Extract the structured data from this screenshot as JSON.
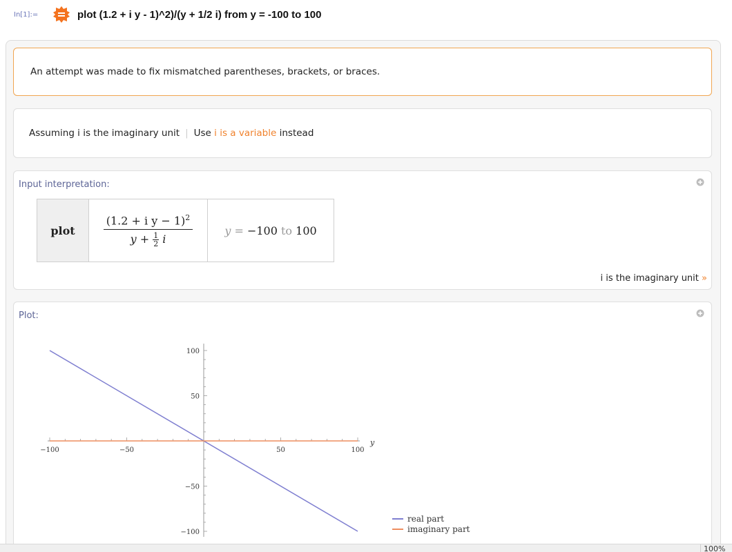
{
  "input_line": {
    "label": "In[1]:=",
    "query": "plot (1.2 + i y - 1)^2)/(y + 1/2 i) from y = -100 to 100",
    "icon": "wolfram-alpha-icon"
  },
  "warning_pod": {
    "text": "An attempt was made to fix mismatched parentheses, brackets, or braces."
  },
  "assumption_pod": {
    "prefix": "Assuming i is the imaginary unit",
    "separator": "|",
    "use_label": "Use",
    "link_text": "i is a variable",
    "suffix": "instead"
  },
  "interpretation_pod": {
    "title": "Input interpretation:",
    "plot_label": "plot",
    "numerator": "(1.2 + i y − 1)",
    "exponent": "2",
    "denominator_var": "y +",
    "small_num": "1",
    "small_den": "2",
    "denominator_i": "i",
    "range_var": "y =",
    "range_from": "−100",
    "range_to_word": "to",
    "range_to": "100",
    "assumption_text": "i is the imaginary unit",
    "assumption_arrow": "»"
  },
  "plot_pod": {
    "title": "Plot:"
  },
  "chart_data": {
    "type": "line",
    "x": [
      -100,
      100
    ],
    "series": [
      {
        "name": "real part",
        "values": [
          100,
          -100
        ],
        "color": "#7e7ed0"
      },
      {
        "name": "imaginary part",
        "values": [
          0,
          0
        ],
        "color": "#ee8d5f"
      }
    ],
    "xlabel": "y",
    "ylabel": "",
    "xlim": [
      -100,
      100
    ],
    "ylim": [
      -100,
      100
    ],
    "xticks": [
      -100,
      -50,
      50,
      100
    ],
    "yticks": [
      100,
      50,
      -50,
      -100
    ],
    "xtick_labels": [
      "−100",
      "−50",
      "50",
      "100"
    ],
    "ytick_labels": [
      "100",
      "50",
      "−50",
      "−100"
    ],
    "legend_position": "bottom-right"
  },
  "status": {
    "zoom": "100%"
  }
}
